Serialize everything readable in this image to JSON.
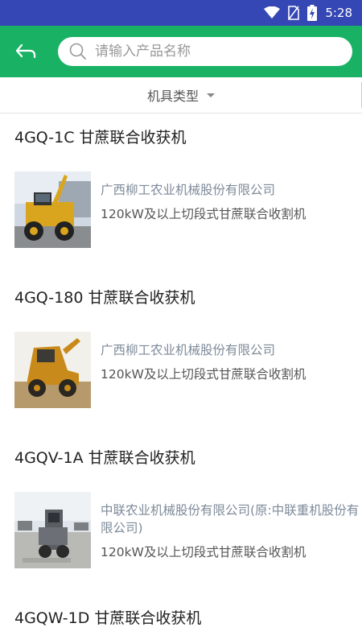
{
  "status_bar": {
    "time": "5:28"
  },
  "search": {
    "placeholder": "请输入产品名称"
  },
  "filter": {
    "label": "机具类型"
  },
  "products": [
    {
      "title": "4GQ-1C 甘蔗联合收获机",
      "company": "广西柳工农业机械股份有限公司",
      "category": "120kW及以上切段式甘蔗联合收割机",
      "image": "harvester-yellow-factory"
    },
    {
      "title": "4GQ-180 甘蔗联合收获机",
      "company": "广西柳工农业机械股份有限公司",
      "category": "120kW及以上切段式甘蔗联合收割机",
      "image": "harvester-yellow-field"
    },
    {
      "title": "4GQV-1A 甘蔗联合收获机",
      "company": "中联农业机械股份有限公司(原:中联重机股份有限公司)",
      "category": "120kW及以上切段式甘蔗联合收割机",
      "image": "harvester-grey-yard"
    },
    {
      "title": "4GQW-1D 甘蔗联合收获机"
    }
  ],
  "colors": {
    "status_bar": "#3547b4",
    "app_bar": "#19b265",
    "company_text": "#7d8a99"
  }
}
